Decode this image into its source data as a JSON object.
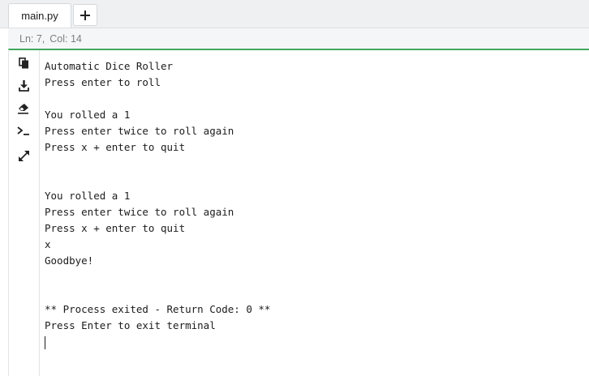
{
  "tabs": [
    {
      "label": "main.py",
      "active": true
    }
  ],
  "tab_add": {
    "icon": "plus-icon"
  },
  "status": {
    "line": "Ln: 7,",
    "col": "Col: 14"
  },
  "toolbar": {
    "icons": [
      "copy-icon",
      "download-icon",
      "eraser-icon",
      "terminal-icon",
      "expand-icon"
    ]
  },
  "terminal": {
    "lines": [
      "Automatic Dice Roller",
      "Press enter to roll",
      "",
      "You rolled a 1",
      "Press enter twice to roll again",
      "Press x + enter to quit",
      "",
      "",
      "You rolled a 1",
      "Press enter twice to roll again",
      "Press x + enter to quit",
      "x",
      "Goodbye!",
      "",
      "",
      "** Process exited - Return Code: 0 **",
      "Press Enter to exit terminal"
    ]
  },
  "colors": {
    "accent": "#41a85f",
    "tabbar_bg": "#eef0f2",
    "status_text": "#7b7f84"
  }
}
